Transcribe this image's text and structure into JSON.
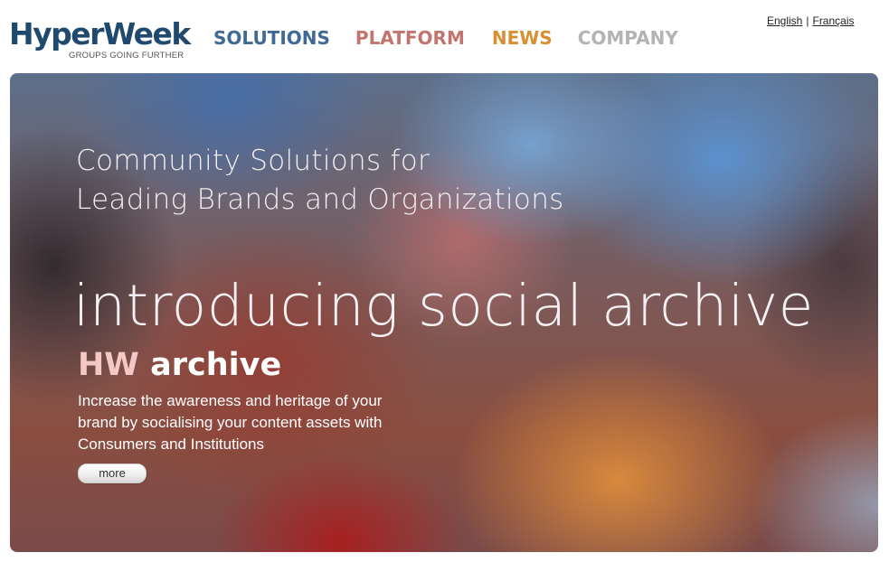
{
  "header": {
    "logo": {
      "name": "HyperWeek",
      "tagline": "GROUPS GOING FURTHER"
    },
    "nav": [
      {
        "label": "SOLUTIONS",
        "color": "#3f6a96"
      },
      {
        "label": "PLATFORM",
        "color": "#c2746f"
      },
      {
        "label": "NEWS",
        "color": "#d98f2f"
      },
      {
        "label": "COMPANY",
        "color": "#b3b3b3"
      }
    ],
    "languages": {
      "english": "English",
      "separator": "|",
      "french": "Français"
    }
  },
  "hero": {
    "heading_line1": "Community Solutions for",
    "heading_line2": "Leading Brands and Organizations",
    "intro": "introducing social archive",
    "product_prefix": "HW",
    "product_name": "archive",
    "description": "Increase the awareness and heritage of your brand by socialising your content assets with Consumers and Institutions",
    "more_label": "more"
  }
}
